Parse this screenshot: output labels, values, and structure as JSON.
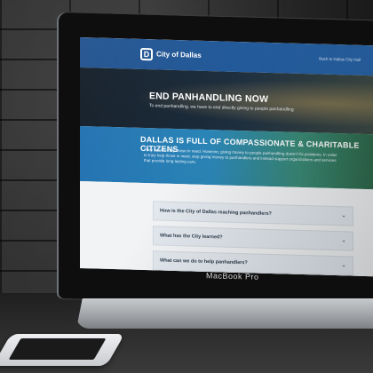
{
  "site": {
    "name": "City of Dallas",
    "logo_letter": "D",
    "header_link": "Back to Dallas City Hall"
  },
  "hero": {
    "title": "END PANHANDLING NOW",
    "subtitle": "To end panhandling, we have to end directly giving to people panhandling"
  },
  "band": {
    "title": "DALLAS IS FULL OF COMPASSIONATE & CHARITABLE CITIZENS",
    "text": "They want to help those in need. However, giving money to people panhandling doesn't fix problems. In order to truly help those in need, stop giving money to panhandlers and instead support organizations and services that provide long-lasting care."
  },
  "faq": {
    "items": [
      {
        "question": "How is the City of Dallas reaching panhandlers?"
      },
      {
        "question": "What has the City learned?"
      },
      {
        "question": "What can we do to help panhandlers?"
      }
    ]
  },
  "device": {
    "brand": "MacBook Pro"
  },
  "colors": {
    "header": "#1d4f8c",
    "band_start": "#1f6fb0",
    "band_end": "#2f6a4b"
  }
}
